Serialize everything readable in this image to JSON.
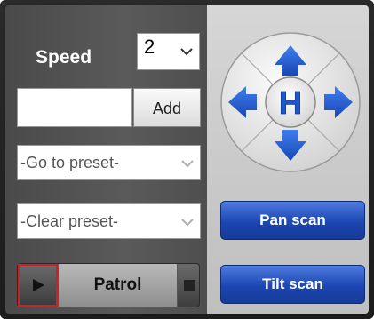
{
  "speed": {
    "label": "Speed",
    "value": "2"
  },
  "preset_entry": {
    "input_value": "",
    "add_label": "Add"
  },
  "goto_preset": {
    "value": "-Go to preset-"
  },
  "clear_preset": {
    "value": "-Clear preset-"
  },
  "patrol": {
    "label": "Patrol"
  },
  "ptz": {
    "home_label": "H"
  },
  "scan": {
    "pan_label": "Pan scan",
    "tilt_label": "Tilt scan"
  },
  "colors": {
    "scan_button": "#1c46b2",
    "ptz_arrow": "#1f56c8",
    "focus_outline": "#d31f1f"
  },
  "icons": [
    "chevron-down-icon",
    "play-icon",
    "stop-icon",
    "arrow-up-icon",
    "arrow-down-icon",
    "arrow-left-icon",
    "arrow-right-icon",
    "home-icon"
  ]
}
